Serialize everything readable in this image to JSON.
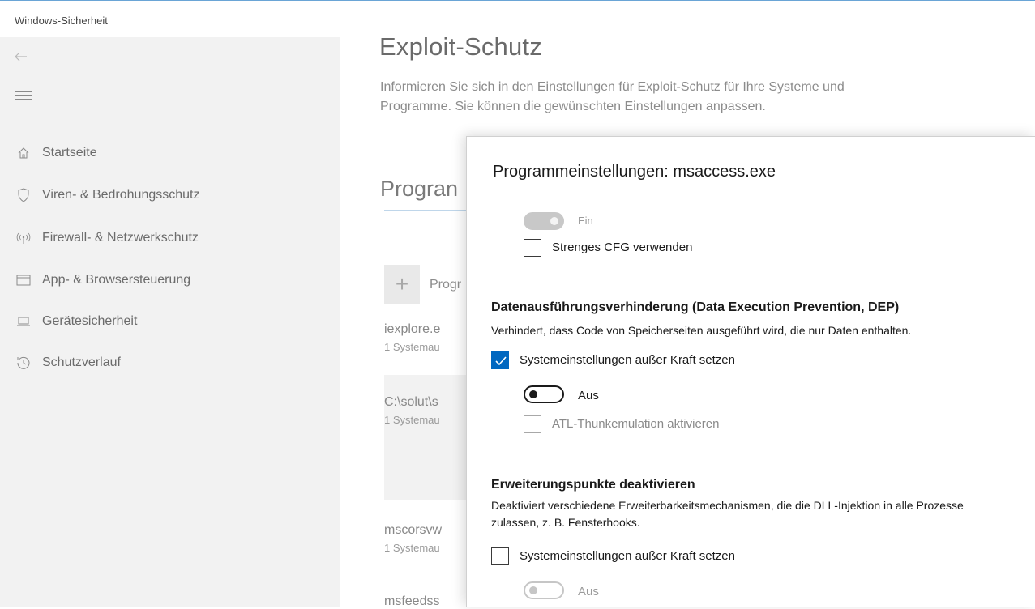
{
  "window": {
    "title": "Windows-Sicherheit"
  },
  "sidebar": {
    "back_icon": "back-arrow-icon",
    "menu_icon": "hamburger-menu-icon",
    "items": [
      {
        "label": "Startseite",
        "icon": "home-icon"
      },
      {
        "label": "Viren- & Bedrohungsschutz",
        "icon": "shield-icon"
      },
      {
        "label": "Firewall- & Netzwerkschutz",
        "icon": "wireless-antenna-icon"
      },
      {
        "label": "App- & Browsersteuerung",
        "icon": "browser-window-icon"
      },
      {
        "label": "Gerätesicherheit",
        "icon": "laptop-icon"
      },
      {
        "label": "Schutzverlauf",
        "icon": "history-clock-icon"
      }
    ]
  },
  "main": {
    "title": "Exploit-Schutz",
    "description": "Informieren Sie sich in den Einstellungen für Exploit-Schutz für Ihre Systeme und Programme. Sie können die gewünschten Einstellungen anpassen.",
    "section_heading": "Progran",
    "add_button_label": "Progr",
    "programs": [
      {
        "name": "iexplore.e",
        "sub": "1 Systemau"
      },
      {
        "name": "C:\\solut\\s",
        "sub": "1 Systemau"
      },
      {
        "name": "mscorsvw",
        "sub": "1 Systemau"
      },
      {
        "name": "msfeedss",
        "sub": ""
      }
    ]
  },
  "dialog": {
    "title": "Programmeinstellungen: msaccess.exe",
    "cfg": {
      "toggle_label": "Ein",
      "strict_label": "Strenges CFG verwenden",
      "strict_checked": false
    },
    "dep": {
      "title": "Datenausführungsverhinderung (Data Execution Prevention, DEP)",
      "description": "Verhindert, dass Code von Speicherseiten ausgeführt wird, die nur Daten enthalten.",
      "override_label": "Systemeinstellungen außer Kraft setzen",
      "override_checked": true,
      "toggle_label": "Aus",
      "atl_label": "ATL-Thunkemulation aktivieren",
      "atl_checked": false
    },
    "extension_points": {
      "title": "Erweiterungspunkte deaktivieren",
      "description": "Deaktiviert verschiedene Erweiterbarkeitsmechanismen, die die DLL-Injektion in alle Prozesse zulassen, z. B. Fensterhooks.",
      "override_label": "Systemeinstellungen außer Kraft setzen",
      "override_checked": false,
      "toggle_label": "Aus"
    },
    "accent_color": "#0067c0"
  }
}
